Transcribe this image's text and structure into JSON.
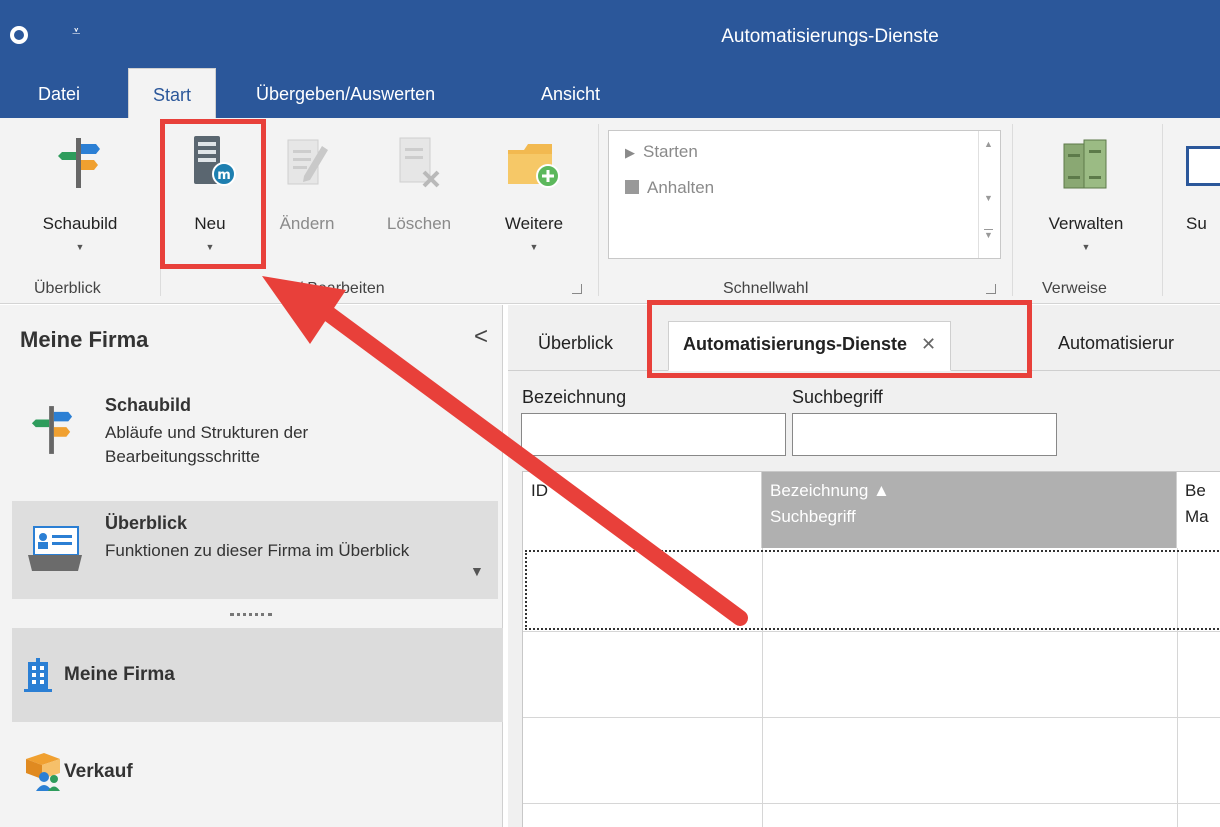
{
  "window": {
    "title": "Automatisierungs-Dienste",
    "qa_glyph": "⩡",
    "accent_color": "#2b579a"
  },
  "menu": {
    "tabs": [
      "Datei",
      "Start",
      "Übergeben/Auswerten",
      "Ansicht"
    ],
    "active_tab": "Start"
  },
  "ribbon": {
    "buttons": {
      "schaubild": "Schaubild",
      "neu": "Neu",
      "aendern": "Ändern",
      "loeschen": "Löschen",
      "weitere": "Weitere",
      "verwalten": "Verwalten",
      "partial": "Su"
    },
    "groups": {
      "ueberblick": "Überblick",
      "bearbeiten": "u / Bearbeiten",
      "schnellwahl": "Schnellwahl",
      "verweise": "Verweise"
    },
    "schnellwahl_items": [
      "Starten",
      "Anhalten"
    ]
  },
  "left_panel": {
    "title": "Meine Firma",
    "collapse_glyph": "<",
    "cards": [
      {
        "title": "Schaubild",
        "desc": "Abläufe und Strukturen der Bearbeitungsschritte"
      },
      {
        "title": "Überblick",
        "desc": "Funktionen zu dieser Firma im Überblick"
      }
    ],
    "nav": [
      "Meine Firma",
      "Verkauf"
    ]
  },
  "main": {
    "tabs": [
      "Überblick",
      "Automatisierungs-Dienste",
      "Automatisierur"
    ],
    "active_tab": "Automatisierungs-Dienste",
    "close_glyph": "✕",
    "filters": {
      "label_1": "Bezeichnung",
      "label_2": "Suchbegriff"
    },
    "grid": {
      "col_id": "ID",
      "col_bez": "Bezeichnung ▲",
      "col_bez_sub": "Suchbegriff",
      "col_next": "Be",
      "col_next_sub": "Ma"
    }
  },
  "annotation": {
    "color": "#e8403a"
  }
}
